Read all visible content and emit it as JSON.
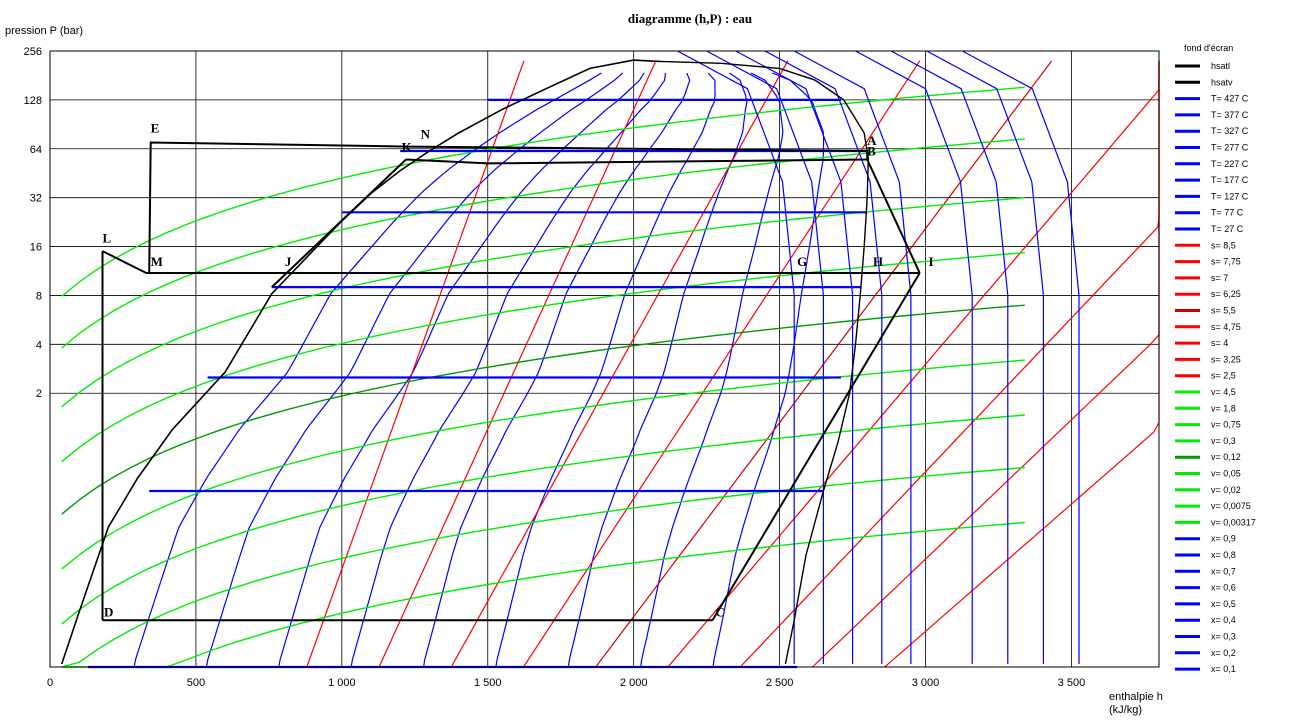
{
  "chart_data": {
    "type": "line",
    "title": "diagramme (h,P) : eau",
    "xlabel": "enthalpie  h",
    "xunit": "(kJ/kg)",
    "ylabel": "pression  P (bar)",
    "xlim": [
      0,
      3800
    ],
    "ylim_log2": [
      -4.6,
      8.0
    ],
    "y_scale": "log",
    "grid": true,
    "x_ticks": [
      {
        "v": 0,
        "label": "0"
      },
      {
        "v": 500,
        "label": "500"
      },
      {
        "v": 1000,
        "label": "1 000"
      },
      {
        "v": 1500,
        "label": "1 500"
      },
      {
        "v": 2000,
        "label": "2 000"
      },
      {
        "v": 2500,
        "label": "2 500"
      },
      {
        "v": 3000,
        "label": "3 000"
      },
      {
        "v": 3500,
        "label": "3 500"
      }
    ],
    "y_ticks": [
      {
        "v": 256,
        "label": "256"
      },
      {
        "v": 128,
        "label": "128"
      },
      {
        "v": 64,
        "label": "64"
      },
      {
        "v": 32,
        "label": "32"
      },
      {
        "v": 16,
        "label": "16"
      },
      {
        "v": 8,
        "label": "8"
      },
      {
        "v": 4,
        "label": "4"
      },
      {
        "v": 2,
        "label": "2"
      }
    ],
    "legend_title": "fond d'écran",
    "legend": [
      {
        "name": "hsatl",
        "color": "#000000"
      },
      {
        "name": "hsatv",
        "color": "#000000"
      },
      {
        "name": "T= 427 C",
        "color": "#0000ff"
      },
      {
        "name": "T= 377 C",
        "color": "#0000ff"
      },
      {
        "name": "T= 327 C",
        "color": "#0000ff"
      },
      {
        "name": "T= 277 C",
        "color": "#0000ff"
      },
      {
        "name": "T= 227 C",
        "color": "#0000ff"
      },
      {
        "name": "T= 177 C",
        "color": "#0000ff"
      },
      {
        "name": "T= 127 C",
        "color": "#0000ff"
      },
      {
        "name": "T= 77 C",
        "color": "#0000ff"
      },
      {
        "name": "T= 27 C",
        "color": "#0000ff"
      },
      {
        "name": "s= 8,5",
        "color": "#ff0000"
      },
      {
        "name": "s= 7,75",
        "color": "#ff0000"
      },
      {
        "name": "s= 7",
        "color": "#ff0000"
      },
      {
        "name": "s= 6,25",
        "color": "#ff0000"
      },
      {
        "name": "s= 5,5",
        "color": "#cc0000"
      },
      {
        "name": "s= 4,75",
        "color": "#ff0000"
      },
      {
        "name": "s= 4",
        "color": "#ff0000"
      },
      {
        "name": "s= 3,25",
        "color": "#ff0000"
      },
      {
        "name": "s= 2,5",
        "color": "#ff0000"
      },
      {
        "name": "v= 4,5",
        "color": "#00ee00"
      },
      {
        "name": "v= 1,8",
        "color": "#00ee00"
      },
      {
        "name": "v= 0,75",
        "color": "#00ee00"
      },
      {
        "name": "v= 0,3",
        "color": "#00ee00"
      },
      {
        "name": "v= 0,12",
        "color": "#009900"
      },
      {
        "name": "v= 0,05",
        "color": "#00ee00"
      },
      {
        "name": "v= 0,02",
        "color": "#00ee00"
      },
      {
        "name": "v= 0,0075",
        "color": "#00ee00"
      },
      {
        "name": "v= 0,00317",
        "color": "#00ee00"
      },
      {
        "name": "x= 0,9",
        "color": "#0000ff"
      },
      {
        "name": "x= 0,8",
        "color": "#0000ff"
      },
      {
        "name": "x= 0,7",
        "color": "#0000ff"
      },
      {
        "name": "x= 0,6",
        "color": "#0000ff"
      },
      {
        "name": "x= 0,5",
        "color": "#0000ff"
      },
      {
        "name": "x= 0,4",
        "color": "#0000ff"
      },
      {
        "name": "x= 0,3",
        "color": "#0000ff"
      },
      {
        "name": "x= 0,2",
        "color": "#0000ff"
      },
      {
        "name": "x= 0,1",
        "color": "#0000ff"
      }
    ],
    "saturation_dome": {
      "liquid": [
        [
          40,
          0.043
        ],
        [
          100,
          0.09
        ],
        [
          200,
          0.3
        ],
        [
          300,
          0.6
        ],
        [
          420,
          1.2
        ],
        [
          600,
          2.7
        ],
        [
          760,
          8.2
        ],
        [
          900,
          15
        ],
        [
          1000,
          23
        ],
        [
          1100,
          34
        ],
        [
          1200,
          47
        ],
        [
          1300,
          62
        ],
        [
          1400,
          80
        ],
        [
          1550,
          112
        ],
        [
          1700,
          150
        ],
        [
          1850,
          200
        ],
        [
          2000,
          225
        ],
        [
          2090,
          221
        ]
      ],
      "vapor": [
        [
          2090,
          221
        ],
        [
          2300,
          215
        ],
        [
          2500,
          200
        ],
        [
          2620,
          170
        ],
        [
          2720,
          128
        ],
        [
          2790,
          80
        ],
        [
          2804,
          56
        ],
        [
          2800,
          32
        ],
        [
          2790,
          16
        ],
        [
          2776,
          8
        ],
        [
          2760,
          4
        ],
        [
          2740,
          2
        ],
        [
          2700,
          1
        ],
        [
          2650,
          0.5
        ],
        [
          2590,
          0.2
        ],
        [
          2550,
          0.08
        ],
        [
          2520,
          0.043
        ]
      ]
    },
    "cycle": [
      {
        "segment": "D-C",
        "points": [
          [
            180,
            0.08
          ],
          [
            2270,
            0.08
          ]
        ]
      },
      {
        "segment": "C-I",
        "points": [
          [
            2270,
            0.08
          ],
          [
            2980,
            11
          ]
        ]
      },
      {
        "segment": "I-L",
        "points": [
          [
            2980,
            11
          ],
          [
            330,
            11
          ],
          [
            180,
            15
          ]
        ]
      },
      {
        "segment": "L-D",
        "points": [
          [
            180,
            15
          ],
          [
            180,
            0.08
          ]
        ]
      },
      {
        "segment": "E-A-B",
        "points": [
          [
            340,
            11
          ],
          [
            345,
            70
          ],
          [
            1230,
            66
          ],
          [
            2800,
            62
          ],
          [
            2800,
            55
          ],
          [
            1500,
            52
          ],
          [
            1220,
            55
          ]
        ]
      },
      {
        "segment": "B-I",
        "points": [
          [
            2800,
            55
          ],
          [
            2980,
            11
          ]
        ]
      },
      {
        "segment": "K-J",
        "points": [
          [
            1220,
            55
          ],
          [
            760,
            9
          ]
        ]
      }
    ],
    "point_labels": [
      {
        "name": "A",
        "h": 2800,
        "P": 64
      },
      {
        "name": "B",
        "h": 2800,
        "P": 55
      },
      {
        "name": "C",
        "h": 2280,
        "P": 0.08
      },
      {
        "name": "D",
        "h": 185,
        "P": 0.08
      },
      {
        "name": "E",
        "h": 345,
        "P": 76
      },
      {
        "name": "G",
        "h": 2560,
        "P": 11.5
      },
      {
        "name": "H",
        "h": 2820,
        "P": 11.5
      },
      {
        "name": "I",
        "h": 3010,
        "P": 11.5
      },
      {
        "name": "J",
        "h": 805,
        "P": 11.5
      },
      {
        "name": "K",
        "h": 1205,
        "P": 58
      },
      {
        "name": "L",
        "h": 180,
        "P": 16
      },
      {
        "name": "M",
        "h": 345,
        "P": 11.5
      },
      {
        "name": "N",
        "h": 1270,
        "P": 70
      }
    ],
    "isobars_blue": [
      {
        "P": 128,
        "h": [
          1500,
          2710
        ]
      },
      {
        "P": 62,
        "h": [
          1200,
          2800
        ]
      },
      {
        "P": 26,
        "h": [
          1000,
          2800
        ]
      },
      {
        "P": 9,
        "h": [
          760,
          2780
        ]
      },
      {
        "P": 2.5,
        "h": [
          540,
          2710
        ]
      },
      {
        "P": 0.5,
        "h": [
          340,
          2650
        ]
      },
      {
        "P": 0.04,
        "h": [
          130,
          2560
        ]
      }
    ],
    "isotherms_T": [
      {
        "name": "T= 27 C",
        "h_vap": 2550
      },
      {
        "name": "T= 77 C",
        "h_vap": 2640
      },
      {
        "name": "T= 127 C",
        "h_vap": 2720
      },
      {
        "name": "T= 177 C",
        "h_vap": 2780
      },
      {
        "name": "T= 227 C",
        "h_vap": 2800
      },
      {
        "name": "T= 277 C",
        "h_vap": 2800
      },
      {
        "name": "T= 327 C",
        "h_vap": 2750
      },
      {
        "name": "T= 377 C",
        "h_vap": 2600
      },
      {
        "name": "T= 427 C",
        "h_vap": 2500
      }
    ]
  }
}
